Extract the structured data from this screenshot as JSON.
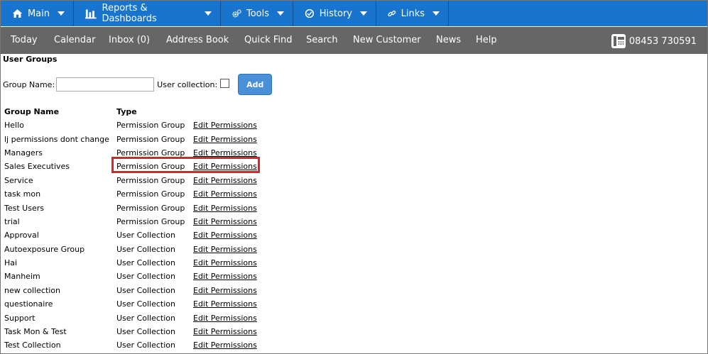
{
  "topnav": {
    "items": [
      {
        "label": "Main",
        "icon": "home-icon"
      },
      {
        "label": "Reports & Dashboards",
        "icon": "bar-chart-icon"
      },
      {
        "label": "Tools",
        "icon": "gears-icon"
      },
      {
        "label": "History",
        "icon": "history-icon"
      },
      {
        "label": "Links",
        "icon": "link-icon"
      }
    ],
    "bg_color": "#1874cd"
  },
  "subnav": {
    "links": [
      "Today",
      "Calendar",
      "Inbox (0)",
      "Address Book",
      "Quick Find",
      "Search",
      "New Customer",
      "News",
      "Help"
    ],
    "phone": "08453 730591",
    "bg_color": "#666666"
  },
  "page": {
    "title": "User Groups",
    "group_name_label": "Group Name:",
    "group_name_value": "",
    "user_collection_label": "User collection:",
    "add_label": "Add"
  },
  "table": {
    "headers": [
      "Group Name",
      "Type"
    ],
    "rows": [
      {
        "name": "Hello",
        "type": "Permission Group",
        "action": "Edit Permissions"
      },
      {
        "name": "lj permissions dont change",
        "type": "Permission Group",
        "action": "Edit Permissions"
      },
      {
        "name": "Managers",
        "type": "Permission Group",
        "action": "Edit Permissions"
      },
      {
        "name": "Sales Executives",
        "type": "Permission Group",
        "action": "Edit Permissions"
      },
      {
        "name": "Service",
        "type": "Permission Group",
        "action": "Edit Permissions"
      },
      {
        "name": "task mon",
        "type": "Permission Group",
        "action": "Edit Permissions"
      },
      {
        "name": "Test Users",
        "type": "Permission Group",
        "action": "Edit Permissions"
      },
      {
        "name": "trial",
        "type": "Permission Group",
        "action": "Edit Permissions"
      },
      {
        "name": "Approval",
        "type": "User Collection",
        "action": "Edit Permissions"
      },
      {
        "name": "Autoexposure Group",
        "type": "User Collection",
        "action": "Edit Permissions"
      },
      {
        "name": "Hai",
        "type": "User Collection",
        "action": "Edit Permissions"
      },
      {
        "name": "Manheim",
        "type": "User Collection",
        "action": "Edit Permissions"
      },
      {
        "name": "new collection",
        "type": "User Collection",
        "action": "Edit Permissions"
      },
      {
        "name": "questionaire",
        "type": "User Collection",
        "action": "Edit Permissions"
      },
      {
        "name": "Support",
        "type": "User Collection",
        "action": "Edit Permissions"
      },
      {
        "name": "Task Mon & Test",
        "type": "User Collection",
        "action": "Edit Permissions"
      },
      {
        "name": "Test Collection",
        "type": "User Collection",
        "action": "Edit Permissions"
      }
    ],
    "highlight_color": "#e0202a"
  }
}
